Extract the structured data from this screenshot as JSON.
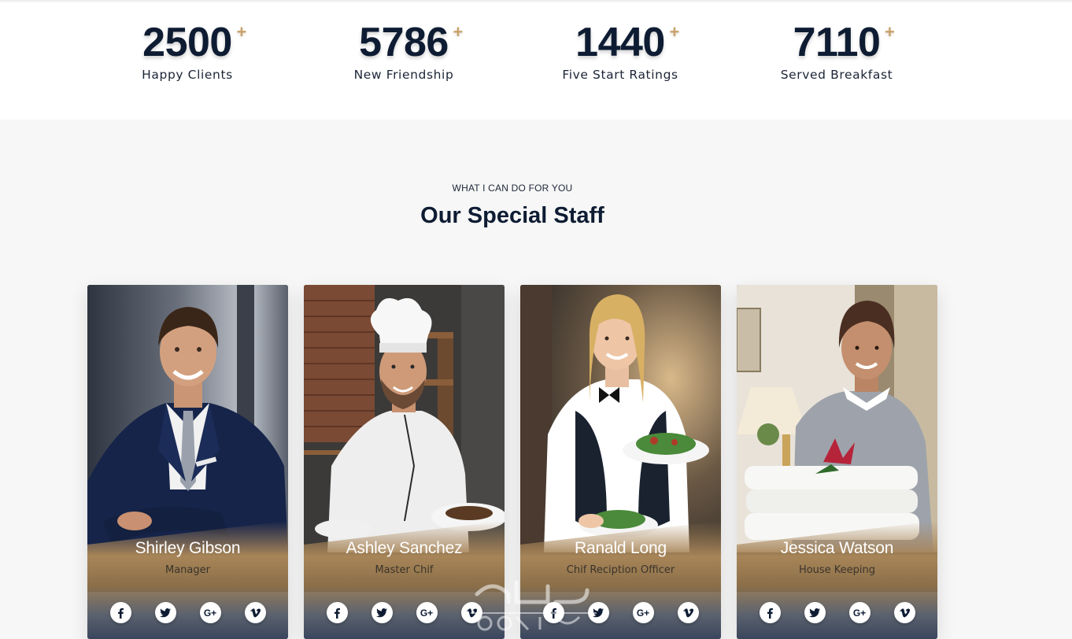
{
  "stats": [
    {
      "value": "2500+",
      "label": "Happy Clients"
    },
    {
      "value": "5786+",
      "label": "New Friendship"
    },
    {
      "value": "1440+",
      "label": "Five Start Ratings"
    },
    {
      "value": "7110+",
      "label": "Served Breakfast"
    }
  ],
  "plus_sign": "+",
  "section": {
    "subtitle": "WHAT I CAN DO FOR YOU",
    "title": "Our Special Staff"
  },
  "staff": [
    {
      "name": "Shirley Gibson",
      "role": "Manager"
    },
    {
      "name": "Ashley Sanchez",
      "role": "Master Chif"
    },
    {
      "name": "Ranald Long",
      "role": "Chif Reciption Officer"
    },
    {
      "name": "Jessica Watson",
      "role": "House Keeping"
    }
  ],
  "social_icons": [
    "facebook-icon",
    "twitter-icon",
    "google-plus-icon",
    "vimeo-icon"
  ],
  "social_labels": {
    "google_plus": "G+"
  },
  "watermark": {
    "arabic": "مستقل",
    "latin": "mostaql.com"
  },
  "colors": {
    "navy": "#0e1c33",
    "gold": "#c8a16a",
    "section_bg": "#f7f7f7"
  }
}
